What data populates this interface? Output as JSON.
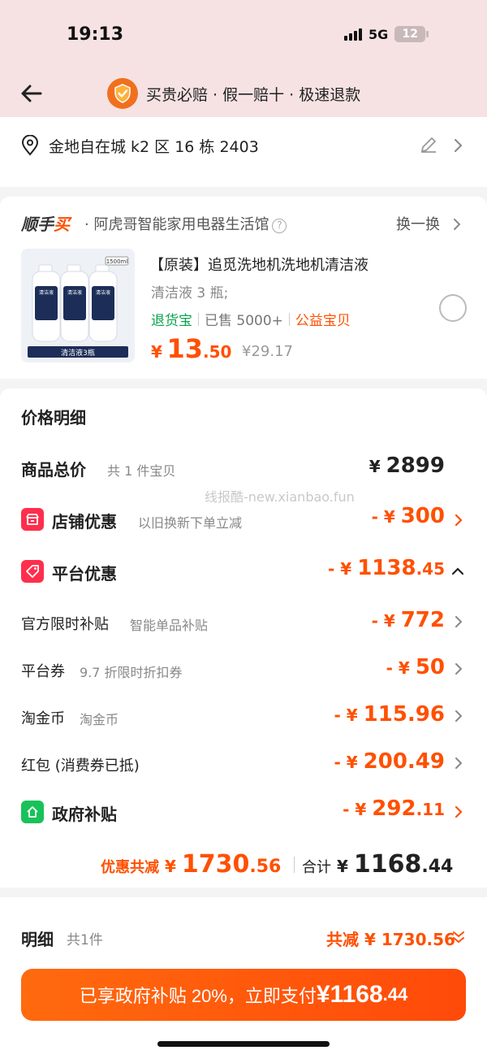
{
  "status_bar": {
    "time": "19:13",
    "network": "5G",
    "battery": "12"
  },
  "header": {
    "guarantee_text": "买贵必赔 · 假一赔十 · 极速退款"
  },
  "address": {
    "text": "金地自在城 k2 区 16 栋 2403"
  },
  "shop": {
    "logo_part1": "顺手",
    "logo_part2": "买",
    "name": "· 阿虎哥智能家用电器生活馆",
    "swap_label": "换一换",
    "product": {
      "image_badge": "1500ml",
      "image_caption": "清洁液3瓶",
      "bottle_label": "清洁液",
      "title": "【原装】追觅洗地机洗地机清洁液",
      "spec": "清洁液 3 瓶;",
      "tag_return": "退货宝",
      "tag_sold": "已售 5000+",
      "tag_charity": "公益宝贝",
      "price_currency": "¥",
      "price_int": "13",
      "price_dec": ".50",
      "original_price": "¥29.17"
    }
  },
  "detail": {
    "title": "价格明细",
    "watermark": "线报酷-new.xianbao.fun",
    "rows": [
      {
        "label": "商品总价",
        "sub": "共 1 件宝贝",
        "cur": "¥ ",
        "int": "2899",
        "dec": ""
      },
      {
        "label": "店铺优惠",
        "sub": "以旧换新下单立减",
        "cur": "- ¥ ",
        "int": "300",
        "dec": ""
      },
      {
        "label": "平台优惠",
        "sub": "",
        "cur": "- ¥ ",
        "int": "1138",
        "dec": ".45"
      },
      {
        "label": "官方限时补贴",
        "sub": "智能单品补贴",
        "cur": "- ¥ ",
        "int": "772",
        "dec": ""
      },
      {
        "label": "平台券",
        "sub": "9.7 折限时折扣券",
        "cur": "- ¥ ",
        "int": "50",
        "dec": ""
      },
      {
        "label": "淘金币",
        "sub": "淘金币",
        "cur": "- ¥ ",
        "int": "115.96",
        "dec": ""
      },
      {
        "label": "红包 (消费券已抵)",
        "sub": "",
        "cur": "- ¥ ",
        "int": "200.49",
        "dec": ""
      },
      {
        "label": "政府补贴",
        "sub": "",
        "cur": "- ¥ ",
        "int": "292",
        "dec": ".11"
      }
    ],
    "summary": {
      "discount_label": "优惠共减",
      "discount_cur": " ¥ ",
      "discount_int": "1730",
      "discount_dec": ".56",
      "total_label": "合计",
      "total_cur": " ¥ ",
      "total_int": "1168",
      "total_dec": ".44"
    }
  },
  "bottom": {
    "title": "明细",
    "count": "共1件",
    "saved": "共减 ¥ 1730.56",
    "pay_prefix": "已享政府补贴 20%，立即支付",
    "pay_cur": "¥",
    "pay_int": "1168",
    "pay_dec": ".44"
  },
  "colors": {
    "accent": "#ff5000",
    "header_bg": "#f6e2e3",
    "green": "#0aa24c",
    "shop_icon": "#ff2e4d",
    "gov_icon": "#18c25a"
  }
}
